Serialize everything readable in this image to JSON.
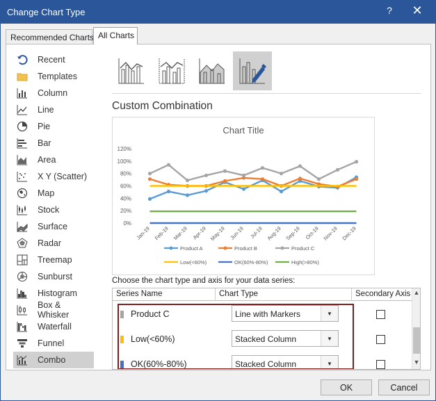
{
  "window": {
    "title": "Change Chart Type",
    "help_glyph": "?",
    "close_glyph": "✕"
  },
  "tabs": [
    {
      "label": "Recommended Charts"
    },
    {
      "label": "All Charts"
    }
  ],
  "sidebar": {
    "items": [
      {
        "label": "Recent",
        "icon": "recent-icon"
      },
      {
        "label": "Templates",
        "icon": "folder-icon"
      },
      {
        "label": "Column",
        "icon": "column-chart-icon"
      },
      {
        "label": "Line",
        "icon": "line-chart-icon"
      },
      {
        "label": "Pie",
        "icon": "pie-chart-icon"
      },
      {
        "label": "Bar",
        "icon": "bar-chart-icon"
      },
      {
        "label": "Area",
        "icon": "area-chart-icon"
      },
      {
        "label": "X Y (Scatter)",
        "icon": "scatter-chart-icon"
      },
      {
        "label": "Map",
        "icon": "map-chart-icon"
      },
      {
        "label": "Stock",
        "icon": "stock-chart-icon"
      },
      {
        "label": "Surface",
        "icon": "surface-chart-icon"
      },
      {
        "label": "Radar",
        "icon": "radar-chart-icon"
      },
      {
        "label": "Treemap",
        "icon": "treemap-chart-icon"
      },
      {
        "label": "Sunburst",
        "icon": "sunburst-chart-icon"
      },
      {
        "label": "Histogram",
        "icon": "histogram-chart-icon"
      },
      {
        "label": "Box & Whisker",
        "icon": "box-whisker-chart-icon"
      },
      {
        "label": "Waterfall",
        "icon": "waterfall-chart-icon"
      },
      {
        "label": "Funnel",
        "icon": "funnel-chart-icon"
      },
      {
        "label": "Combo",
        "icon": "combo-chart-icon",
        "selected": true
      }
    ]
  },
  "combo_types": [
    "clustered-column-line-icon",
    "clustered-column-line-secondary-icon",
    "stacked-area-column-icon",
    "custom-combination-icon"
  ],
  "main": {
    "section_title": "Custom Combination",
    "choose_label": "Choose the chart type and axis for your data series:"
  },
  "series_table": {
    "headers": {
      "name": "Series Name",
      "type": "Chart Type",
      "axis": "Secondary Axis"
    },
    "rows": [
      {
        "name": "Product C",
        "type": "Line with Markers",
        "color": "#a5a5a5",
        "secondary": false
      },
      {
        "name": "Low(<60%)",
        "type": "Stacked Column",
        "color": "#ffc000",
        "secondary": false
      },
      {
        "name": "OK(60%-80%)",
        "type": "Stacked Column",
        "color": "#4472c4",
        "secondary": false
      }
    ]
  },
  "buttons": {
    "ok": "OK",
    "cancel": "Cancel"
  },
  "colors": {
    "titlebar": "#2b579a",
    "highlight_box": "#7b1e1e",
    "product_a": "#5b9bd5",
    "product_b": "#ed7d31",
    "product_c": "#a5a5a5",
    "low": "#ffc000",
    "ok": "#4472c4",
    "high": "#70ad47"
  },
  "chart_data": {
    "type": "line",
    "title": "Chart Title",
    "categories": [
      "Jan-19",
      "Feb-19",
      "Mar-19",
      "Apr-19",
      "May-19",
      "Jun-19",
      "Jul-19",
      "Aug-19",
      "Sep-19",
      "Oct-19",
      "Nov-19",
      "Dec-19"
    ],
    "ytick_labels": [
      "0%",
      "20%",
      "40%",
      "60%",
      "80%",
      "100%",
      "120%"
    ],
    "ylim": [
      0,
      120
    ],
    "grid": false,
    "legend": "bottom",
    "series": [
      {
        "name": "Product A",
        "color": "#5b9bd5",
        "marker": true,
        "values": [
          39,
          51,
          45,
          52,
          66,
          55,
          69,
          51,
          68,
          59,
          57,
          74
        ]
      },
      {
        "name": "Product B",
        "color": "#ed7d31",
        "marker": true,
        "values": [
          71,
          62,
          60,
          60,
          68,
          73,
          71,
          60,
          72,
          63,
          59,
          71
        ]
      },
      {
        "name": "Product C",
        "color": "#a5a5a5",
        "marker": true,
        "values": [
          80,
          94,
          69,
          77,
          84,
          77,
          89,
          80,
          92,
          71,
          86,
          99
        ]
      },
      {
        "name": "Low(<60%)",
        "color": "#ffc000",
        "marker": false,
        "values": [
          60,
          60,
          60,
          60,
          60,
          60,
          60,
          60,
          60,
          60,
          60,
          60
        ]
      },
      {
        "name": "OK(60%-80%)",
        "color": "#4472c4",
        "marker": false,
        "values": [
          0,
          0,
          0,
          0,
          0,
          0,
          0,
          0,
          0,
          0,
          0,
          0
        ]
      },
      {
        "name": "High(>80%)",
        "color": "#70ad47",
        "marker": false,
        "values": [
          19,
          19,
          19,
          19,
          19,
          19,
          19,
          19,
          19,
          19,
          19,
          19
        ]
      }
    ]
  }
}
